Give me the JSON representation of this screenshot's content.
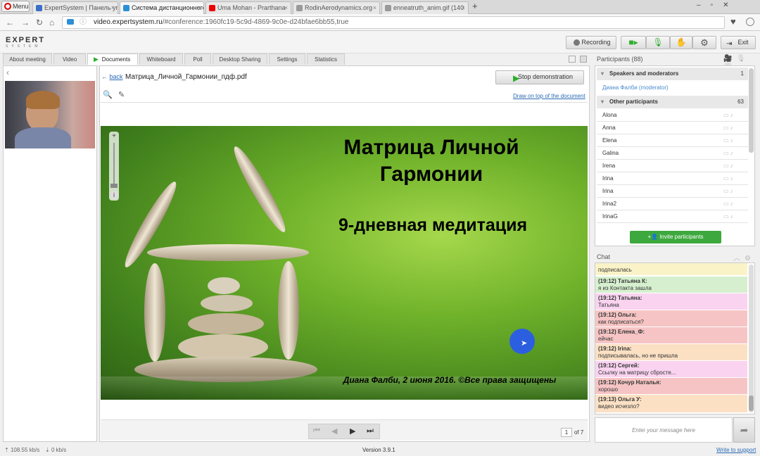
{
  "browser": {
    "menu_label": "Menu",
    "tabs": [
      {
        "label": "ExpertSystem | Панель упр",
        "color": "#3b6fc7"
      },
      {
        "label": "Система дистанционного",
        "color": "#2c8fd6"
      },
      {
        "label": "Uma Mohan - Prarthana",
        "color": "#e00"
      },
      {
        "label": "RodinAerodynamics.org",
        "color": "#888"
      },
      {
        "label": "enneatruth_anim.gif (140",
        "color": "#888"
      }
    ],
    "url_host": "video.expertsystem.ru",
    "url_path": "/#conference:1960fc19-5c9d-4869-9c0e-d24bfae6bb55,true"
  },
  "app": {
    "logo": "EXPERT",
    "logo_sub": "SYSTEM",
    "recording_label": "Recording",
    "exit_label": "Exit",
    "tabs": [
      "About meeting",
      "Video",
      "Documents",
      "Whiteboard",
      "Poll",
      "Desktop Sharing",
      "Settings",
      "Statistics"
    ]
  },
  "document": {
    "back_label": "back",
    "filename": "Матрица_Личной_Гармонии_пдф.pdf",
    "stop_label": "Stop demonstration",
    "draw_label": "Draw on top of the document",
    "slide_title_1": "Матрица Личной",
    "slide_title_2": "Гармонии",
    "slide_subtitle": "9-дневная медитация",
    "slide_footer": "Диана Фалби, 2 июня 2016. ©Все права защищены",
    "page_current": "1",
    "page_total": "of 7"
  },
  "participants": {
    "header": "Participants (88)",
    "speakers_label": "Speakers and moderators",
    "speakers_count": "1",
    "moderator": "Диана Фалби (moderator)",
    "others_label": "Other participants",
    "others_count": "63",
    "names": [
      "Alona",
      "Anna",
      "Elena",
      "Galina",
      "Irena",
      "Irina",
      "Irina",
      "Irina2",
      "IrinaG"
    ],
    "invite_label": "Invite participants"
  },
  "chat": {
    "header": "Chat",
    "messages": [
      {
        "who": "",
        "text": "подписалась",
        "bg": "#fbf3c8"
      },
      {
        "who": "(19:12) Татьяна К:",
        "text": "я из Контакта зашла",
        "bg": "#d6f0cf"
      },
      {
        "who": "(19:12) Татьяна:",
        "text": "Татьяна",
        "bg": "#f9d3f0"
      },
      {
        "who": "(19:12) Ольга:",
        "text": "как подписаться?",
        "bg": "#f6c4c4"
      },
      {
        "who": "(19:12) Елена_Ф:",
        "text": "ейчас",
        "bg": "#f6c4c4"
      },
      {
        "who": "(19:12) Irina:",
        "text": "подписывалась, но не пришла",
        "bg": "#fbe0c4"
      },
      {
        "who": "(19:12) Сергей:",
        "text": "Ссылку на матрицу сбросте...",
        "bg": "#f9d3f0"
      },
      {
        "who": "(19:12) Кочур Наталья:",
        "text": "хорошо",
        "bg": "#f6c4c4"
      },
      {
        "who": "(19:13) Ольга У:",
        "text": "видео исчезло?",
        "bg": "#fbe0c4"
      }
    ],
    "input_placeholder": "Enter your message here"
  },
  "status": {
    "up_rate": "108.55 kb/s",
    "down_rate": "0 kb/s",
    "version": "Version 3.9.1",
    "support": "Write to support"
  }
}
